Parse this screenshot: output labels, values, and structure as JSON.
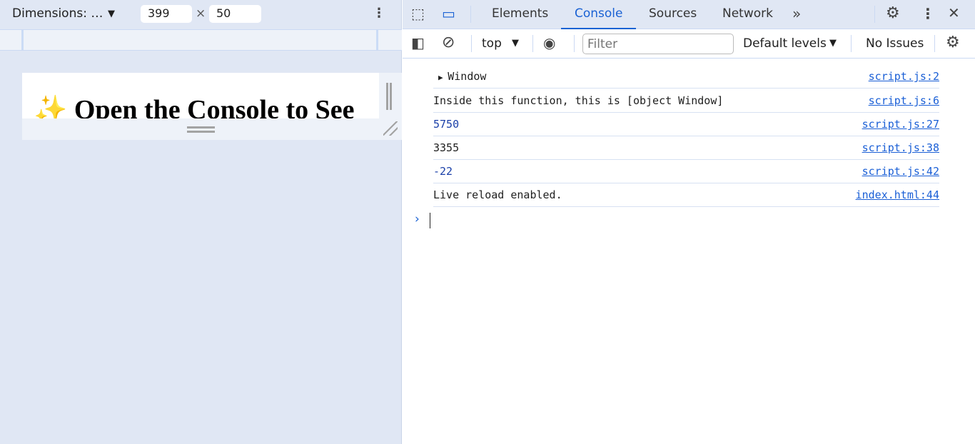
{
  "device_toolbar": {
    "dimensions_label": "Dimensions: …",
    "width": "399",
    "height": "50",
    "times": "×"
  },
  "page": {
    "heading": "✨ Open the Console to See"
  },
  "devtools": {
    "tabs": [
      {
        "label": "Elements"
      },
      {
        "label": "Console",
        "active": true
      },
      {
        "label": "Sources"
      },
      {
        "label": "Network"
      }
    ],
    "console_toolbar": {
      "context": "top",
      "filter_placeholder": "Filter",
      "levels": "Default levels",
      "issues": "No Issues"
    },
    "messages": [
      {
        "text": "Window",
        "source": "script.js:2",
        "expandable": true,
        "type": "object"
      },
      {
        "text": "Inside this function, this is [object Window]",
        "source": "script.js:6",
        "type": "string"
      },
      {
        "text": "5750",
        "source": "script.js:27",
        "type": "number"
      },
      {
        "text": "3355",
        "source": "script.js:38",
        "type": "number"
      },
      {
        "text": "-22",
        "source": "script.js:42",
        "type": "number"
      },
      {
        "text": "Live reload enabled.",
        "source": "index.html:44",
        "type": "string"
      }
    ],
    "prompt": "›"
  },
  "colors": {
    "accent": "#1a62d4",
    "number": "#1a3fa8",
    "link": "#1a5fd6"
  }
}
